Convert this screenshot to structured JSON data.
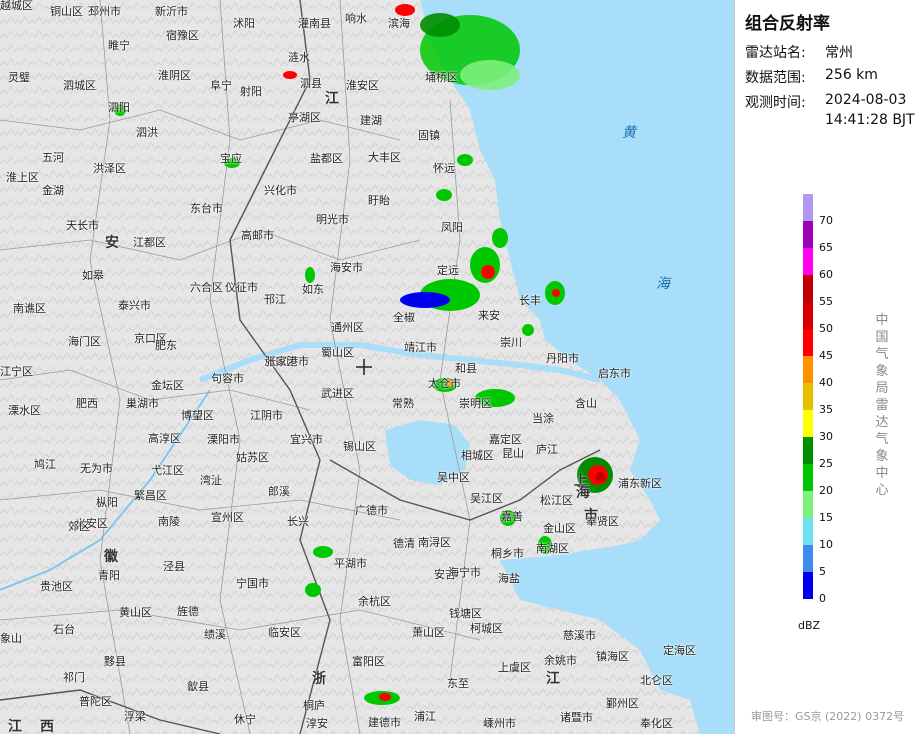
{
  "panel": {
    "title": "组合反射率",
    "station_label": "雷达站名:",
    "station_value": "常州",
    "range_label": "数据范围:",
    "range_value": "256 km",
    "time_label": "观测时间:",
    "time_value_1": "2024-08-03",
    "time_value_2": "14:41:28 BJT",
    "legend_unit": "dBZ",
    "agency": "中国气象局雷达气象中心",
    "approval": "审图号：GS京 (2022) 0372号",
    "legend": [
      {
        "value": "70",
        "color": "#b398f0"
      },
      {
        "value": "65",
        "color": "#9a00b4"
      },
      {
        "value": "60",
        "color": "#ff00f0"
      },
      {
        "value": "55",
        "color": "#c00000"
      },
      {
        "value": "50",
        "color": "#d40000"
      },
      {
        "value": "45",
        "color": "#ff0000"
      },
      {
        "value": "40",
        "color": "#ff9000"
      },
      {
        "value": "35",
        "color": "#e7c000"
      },
      {
        "value": "30",
        "color": "#ffff00"
      },
      {
        "value": "25",
        "color": "#008e00"
      },
      {
        "value": "20",
        "color": "#00c800"
      },
      {
        "value": "15",
        "color": "#7cf07c"
      },
      {
        "value": "10",
        "color": "#6ee0f0"
      },
      {
        "value": "5",
        "color": "#3c8cf0"
      },
      {
        "value": "0",
        "color": "#0000f0"
      }
    ]
  },
  "map": {
    "provinces": [
      "安",
      "江",
      "徽",
      "浙",
      "江",
      "江",
      "西",
      "上",
      "海",
      "市"
    ],
    "seas": [
      "黄",
      "海"
    ],
    "places": [
      "铜山区",
      "邳州市",
      "新沂市",
      "沭阳",
      "灌南县",
      "响水",
      "滨海",
      "睢宁",
      "宿豫区",
      "涟水",
      "埇桥区",
      "灵璧",
      "泗城区",
      "泗阳",
      "淮阴区",
      "阜宁",
      "射阳",
      "泗县",
      "淮安区",
      "建湖",
      "泗洪",
      "亭湖区",
      "固镇",
      "五河",
      "洪泽区",
      "宝应",
      "盐都区",
      "大丰区",
      "怀远",
      "淮上区",
      "金湖",
      "兴化市",
      "盱眙",
      "东台市",
      "凤阳",
      "天长市",
      "高邮市",
      "明光市",
      "江都区",
      "海安市",
      "定远",
      "如皋",
      "来安",
      "六合区",
      "仪征市",
      "邗江",
      "如东",
      "南谯区",
      "泰兴市",
      "长丰",
      "全椒",
      "京口区",
      "通州区",
      "靖江市",
      "崇川",
      "海门区",
      "肥东",
      "浦口区",
      "丹阳市",
      "启东市",
      "蜀山区",
      "江宁区",
      "句容市",
      "张家港市",
      "和县",
      "金坛区",
      "武进区",
      "常熟",
      "崇明区",
      "肥西",
      "巢湖市",
      "含山",
      "溧水区",
      "江阴市",
      "博望区",
      "太仓市",
      "当涂",
      "溧阳市",
      "宜兴市",
      "锡山区",
      "相城区",
      "嘉定区",
      "庐江",
      "鸠江",
      "高淳区",
      "姑苏区",
      "昆山",
      "无为市",
      "弋江区",
      "吴中区",
      "繁昌区",
      "郎溪",
      "浦东新区",
      "湾沚",
      "吴江区",
      "松江区",
      "枞阳",
      "义安区",
      "南陵",
      "宣州区",
      "广德市",
      "长兴",
      "德清",
      "南浔区",
      "嘉善",
      "金山区",
      "奉贤区",
      "郊区",
      "平湖市",
      "青阳",
      "泾县",
      "安吉",
      "桐乡市",
      "南湖区",
      "贵池区",
      "宁国市",
      "余杭区",
      "海宁市",
      "海盐",
      "黄山区",
      "旌德",
      "临安区",
      "钱塘区",
      "萧山区",
      "石台",
      "绩溪",
      "慈溪市",
      "富阳区",
      "柯城区",
      "上虞区",
      "余姚市",
      "镇海区",
      "定海区",
      "北仑区",
      "祁门",
      "黟县",
      "歙县",
      "桐庐",
      "嵊州市",
      "鄞州区",
      "普陀区",
      "浮梁",
      "休宁",
      "淳安",
      "建德市",
      "浦江",
      "诸暨市",
      "奉化区",
      "象山",
      "东至",
      "越城区"
    ]
  }
}
